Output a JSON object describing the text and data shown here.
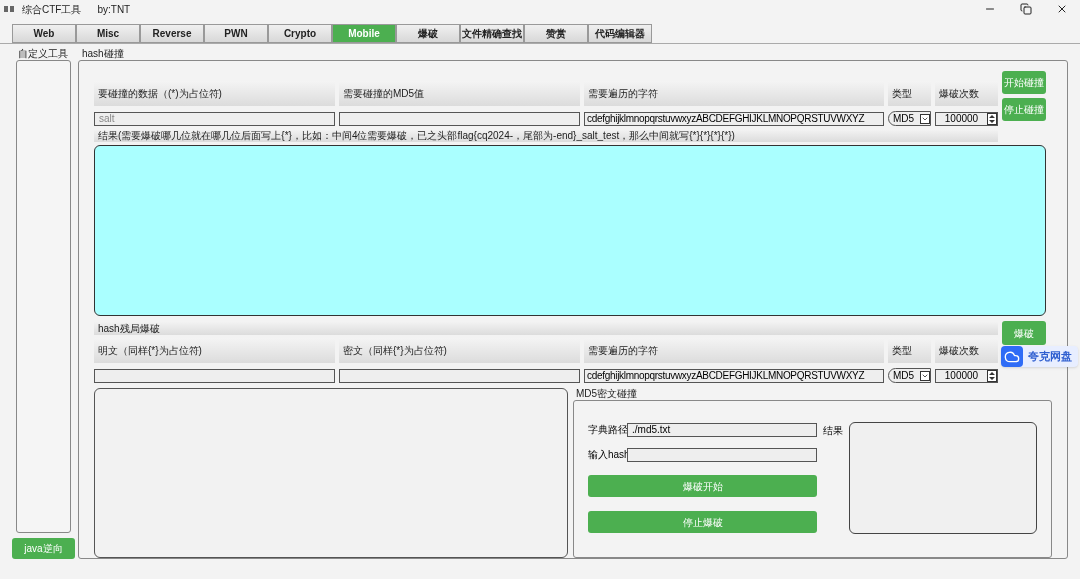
{
  "window": {
    "title": "综合CTF工具",
    "author": "by:TNT"
  },
  "tabs": [
    {
      "label": "Web",
      "selected": false
    },
    {
      "label": "Misc",
      "selected": false
    },
    {
      "label": "Reverse",
      "selected": false
    },
    {
      "label": "PWN",
      "selected": false
    },
    {
      "label": "Crypto",
      "selected": false
    },
    {
      "label": "Mobile",
      "selected": true
    },
    {
      "label": "爆破",
      "selected": false
    },
    {
      "label": "文件精确查找",
      "selected": false
    },
    {
      "label": "赞赏",
      "selected": false
    },
    {
      "label": "代码编辑器",
      "selected": false
    }
  ],
  "sidebar": {
    "title": "自定义工具",
    "button": "java逆向"
  },
  "hash_collision": {
    "title": "hash碰撞",
    "columns": [
      "要碰撞的数据（(*)为占位符)",
      "需要碰撞的MD5值",
      "需要遍历的字符",
      "类型",
      "爆破次数"
    ],
    "data_placeholder": "salt",
    "charset": "cdefghijklmnopqrstuvwxyzABCDEFGHIJKLMNOPQRSTUVWXYZ",
    "type": "MD5",
    "count": "100000",
    "result_hint": "结果(需要爆破哪几位就在哪几位后面写上{*}，比如：中间4位需要爆破，已之头部flag{cq2024-，尾部为-end}_salt_test，那么中间就写{*}{*}{*}{*})",
    "buttons": [
      "开始碰撞",
      "停止碰撞"
    ]
  },
  "hash_endgame": {
    "title": "hash残局爆破",
    "columns": [
      "明文（同样{*}为占位符)",
      "密文（同样{*}为占位符)",
      "需要遍历的字符",
      "类型",
      "爆破次数"
    ],
    "charset": "cdefghijklmnopqrstuvwxyzABCDEFGHIJKLMNOPQRSTUVWXYZ",
    "type": "MD5",
    "count": "100000",
    "button": "爆破"
  },
  "md5_crack": {
    "title": "MD5密文碰撞",
    "dict_label": "字典路径",
    "dict_value": "./md5.txt",
    "hash_label": "输入hash",
    "result_label": "结果",
    "buttons": [
      "爆破开始",
      "停止爆破"
    ]
  },
  "floating_widget": {
    "label": "夸克网盘"
  }
}
